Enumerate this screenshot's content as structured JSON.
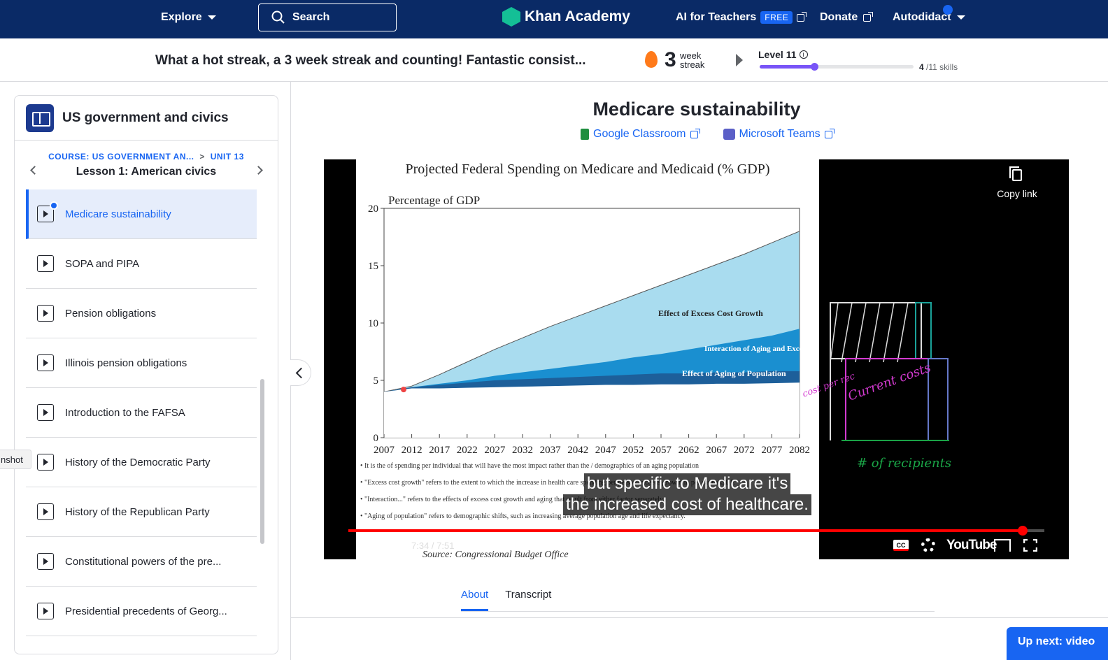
{
  "nav": {
    "explore": "Explore",
    "search_label": "Search",
    "logo": "Khan Academy",
    "ai_teachers": "AI for Teachers",
    "free_badge": "FREE",
    "donate": "Donate",
    "user": "Autodidact"
  },
  "streak": {
    "message": "What a hot streak, a 3 week streak and counting! Fantastic consist...",
    "count": "3",
    "unit_line1": "week",
    "unit_line2": "streak",
    "level": "Level 11",
    "level_progress": 0.36,
    "skills_done": "4",
    "skills_total": "/11 skills"
  },
  "sidebar": {
    "course_title": "US government and civics",
    "breadcrumb_course": "COURSE: US GOVERNMENT AN...",
    "breadcrumb_sep": ">",
    "breadcrumb_unit": "UNIT 13",
    "lesson_title": "Lesson 1: American civics",
    "items": [
      {
        "label": "Medicare sustainability",
        "active": true
      },
      {
        "label": "SOPA and PIPA"
      },
      {
        "label": "Pension obligations"
      },
      {
        "label": "Illinois pension obligations"
      },
      {
        "label": "Introduction to the FAFSA"
      },
      {
        "label": "History of the Democratic Party"
      },
      {
        "label": "History of the Republican Party"
      },
      {
        "label": "Constitutional powers of the pre..."
      },
      {
        "label": "Presidential precedents of Georg..."
      }
    ]
  },
  "tooltip": "nshot",
  "main": {
    "title": "Medicare sustainability",
    "google_classroom": "Google Classroom",
    "microsoft_teams": "Microsoft Teams"
  },
  "player": {
    "copy_link": "Copy link",
    "time": "7:34 / 7:51",
    "progress": 0.969,
    "caption_line1": "but specific to Medicare it's",
    "caption_line2": "the increased cost of healthcare.",
    "cc": "CC",
    "youtube": "YouTube",
    "slide_title": "Projected  Federal Spending on Medicare and Medicaid (% GDP)",
    "slide_notes": [
      "• It is the  of spending per individual that will have the most impact rather than the  / demographics of an aging population",
      "• \"Excess cost growth\" refers to the extent to which the increase in health care spending per person exceeds growth in per capita GDP.",
      "• \"Interaction...\" refers to the effects of excess cost growth and aging that result from either factor separately.",
      "• \"Aging of population\" refers to demographic shifts, such as increasing average population age and life expectancy."
    ],
    "slide_source": "Source: Congressional Budget Office",
    "annotations": {
      "cost_per_rec": "cost per rec",
      "current_costs": "Current costs",
      "num_recipients": "# of recipients"
    }
  },
  "chart_data": {
    "type": "area",
    "title": "Projected  Federal Spending on Medicare and Medicaid (% GDP)",
    "ylabel": "Percentage of GDP",
    "ylim": [
      0,
      20
    ],
    "yticks": [
      0,
      5,
      10,
      15,
      20
    ],
    "x": [
      "2007",
      "2012",
      "2017",
      "2022",
      "2027",
      "2032",
      "2037",
      "2042",
      "2047",
      "2052",
      "2057",
      "2062",
      "2067",
      "2072",
      "2077",
      "2082"
    ],
    "series": [
      {
        "name": "Effect of Aging of Population",
        "color": "#1d5f9a",
        "values": [
          4.0,
          4.4,
          4.6,
          4.8,
          5.0,
          5.1,
          5.2,
          5.3,
          5.4,
          5.5,
          5.6,
          5.6,
          5.7,
          5.7,
          5.8,
          5.8
        ]
      },
      {
        "name": "Interaction of Aging and Excess Cost Growth",
        "color": "#1a8fd0",
        "values": [
          4.0,
          4.4,
          4.7,
          5.0,
          5.4,
          5.7,
          6.0,
          6.3,
          6.6,
          7.0,
          7.3,
          7.7,
          8.1,
          8.5,
          8.9,
          9.5
        ]
      },
      {
        "name": "Effect of Excess Cost Growth",
        "color": "#a9dcef",
        "values": [
          4.0,
          4.5,
          5.5,
          6.6,
          7.7,
          8.7,
          9.7,
          10.6,
          11.5,
          12.4,
          13.3,
          14.2,
          15.1,
          16.0,
          17.0,
          18.0
        ]
      }
    ]
  }
}
